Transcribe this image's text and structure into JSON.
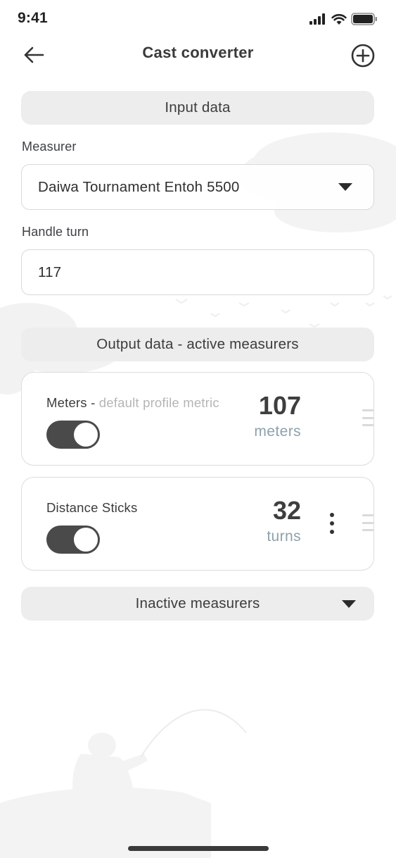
{
  "status_bar": {
    "time": "9:41"
  },
  "header": {
    "title": "Cast converter",
    "back_icon": "arrow-left-icon",
    "add_icon": "plus-circle-icon"
  },
  "input_section": {
    "title": "Input data",
    "measurer_label": "Measurer",
    "measurer_value": "Daiwa Tournament Entoh 5500",
    "handle_turn_label": "Handle turn",
    "handle_turn_value": "117"
  },
  "output_section": {
    "title": "Output data - active measurers",
    "measurers": [
      {
        "name": "Meters",
        "separator": " - ",
        "subtitle": "default profile metric",
        "value": "107",
        "unit": "meters",
        "enabled": true
      },
      {
        "name": "Distance Sticks",
        "value": "32",
        "unit": "turns",
        "enabled": true
      }
    ]
  },
  "inactive_section": {
    "title": "Inactive measurers"
  },
  "colors": {
    "pill_background": "#ededed",
    "toggle_on": "#4a4a4a",
    "unit_text": "#8ea1ac",
    "subtitle_text": "#b5b5b5"
  }
}
